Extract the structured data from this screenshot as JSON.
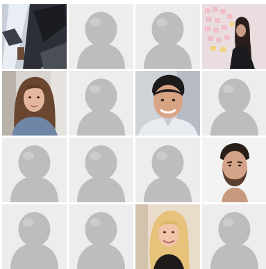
{
  "colors": {
    "placeholder_bg": "#ededed",
    "silhouette": "#bdbdbd",
    "silhouette_highlight": "#d6d6d6",
    "page_bg": "#ffffff"
  },
  "grid": {
    "rows": 4,
    "columns": 4,
    "tiles": [
      {
        "kind": "photo",
        "subject": "blurred-interior-photo"
      },
      {
        "kind": "placeholder",
        "icon": "default-avatar-icon"
      },
      {
        "kind": "placeholder",
        "icon": "default-avatar-icon"
      },
      {
        "kind": "photo",
        "subject": "woman-with-sticky-note-wall"
      },
      {
        "kind": "photo",
        "subject": "woman-long-brown-hair"
      },
      {
        "kind": "placeholder",
        "icon": "default-avatar-icon"
      },
      {
        "kind": "photo",
        "subject": "smiling-man-dark-hair"
      },
      {
        "kind": "placeholder",
        "icon": "default-avatar-icon"
      },
      {
        "kind": "placeholder",
        "icon": "default-avatar-icon"
      },
      {
        "kind": "placeholder",
        "icon": "default-avatar-icon"
      },
      {
        "kind": "placeholder",
        "icon": "default-avatar-icon"
      },
      {
        "kind": "photo",
        "subject": "bearded-man-portrait"
      },
      {
        "kind": "placeholder",
        "icon": "default-avatar-icon"
      },
      {
        "kind": "placeholder",
        "icon": "default-avatar-icon"
      },
      {
        "kind": "photo",
        "subject": "smiling-blonde-woman"
      },
      {
        "kind": "placeholder",
        "icon": "default-avatar-icon"
      }
    ]
  }
}
